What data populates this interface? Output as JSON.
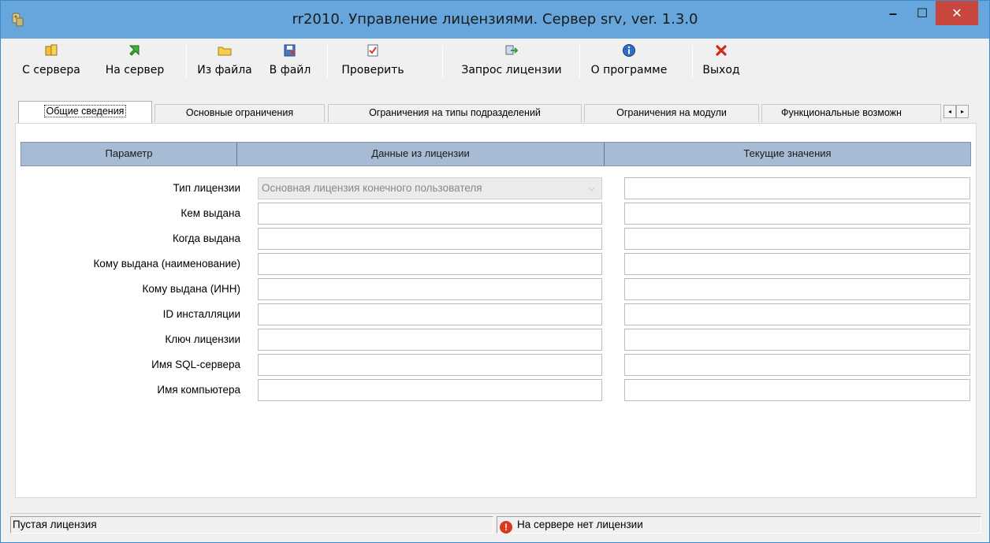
{
  "window": {
    "title": "rr2010. Управление лицензиями. Сервер srv, ver. 1.3.0",
    "min_glyph": "–",
    "max_glyph": "☐",
    "close_glyph": "✕"
  },
  "toolbar": {
    "buttons": [
      {
        "label": "С сервера",
        "icon": "database-cylinder-icon"
      },
      {
        "label": "На сервер",
        "icon": "green-arrow-icon"
      },
      {
        "label": "Из файла",
        "icon": "folder-icon"
      },
      {
        "label": "В файл",
        "icon": "save-icon"
      },
      {
        "label": "Проверить",
        "icon": "check-document-icon"
      },
      {
        "label": "Запрос лицензии",
        "icon": "license-request-icon"
      },
      {
        "label": "О программе",
        "icon": "info-icon"
      },
      {
        "label": "Выход",
        "icon": "red-x-icon"
      }
    ]
  },
  "tabs": [
    {
      "label": "Общие сведения",
      "active": true
    },
    {
      "label": "Основные ограничения",
      "active": false
    },
    {
      "label": "Ограничения на типы подразделений",
      "active": false
    },
    {
      "label": "Ограничения на модули",
      "active": false
    },
    {
      "label": "Функциональные возможн",
      "active": false
    }
  ],
  "tab_scroll": {
    "left": "◂",
    "right": "▸"
  },
  "grid": {
    "headers": [
      "Параметр",
      "Данные из лицензии",
      "Текущие значения"
    ],
    "rows": [
      {
        "label": "Тип лицензии",
        "license_value": "Основная лицензия конечного пользователя",
        "current_value": ""
      },
      {
        "label": "Кем выдана",
        "license_value": "",
        "current_value": ""
      },
      {
        "label": "Когда выдана",
        "license_value": "",
        "current_value": ""
      },
      {
        "label": "Кому выдана (наименование)",
        "license_value": "",
        "current_value": ""
      },
      {
        "label": "Кому выдана (ИНН)",
        "license_value": "",
        "current_value": ""
      },
      {
        "label": "ID инсталляции",
        "license_value": "",
        "current_value": ""
      },
      {
        "label": "Ключ лицензии",
        "license_value": "",
        "current_value": ""
      },
      {
        "label": "Имя SQL-сервера",
        "license_value": "",
        "current_value": ""
      },
      {
        "label": "Имя компьютера",
        "license_value": "",
        "current_value": ""
      }
    ],
    "combo_arrow": "⌵"
  },
  "statusbar": {
    "left_text": "Пустая лицензия",
    "right_text": "На сервере нет лицензии",
    "right_icon": "error-icon",
    "error_glyph": "!"
  },
  "colors": {
    "titlebar": "#66a6dc",
    "close_button": "#c7463d",
    "grid_header": "#a7bcd4"
  }
}
